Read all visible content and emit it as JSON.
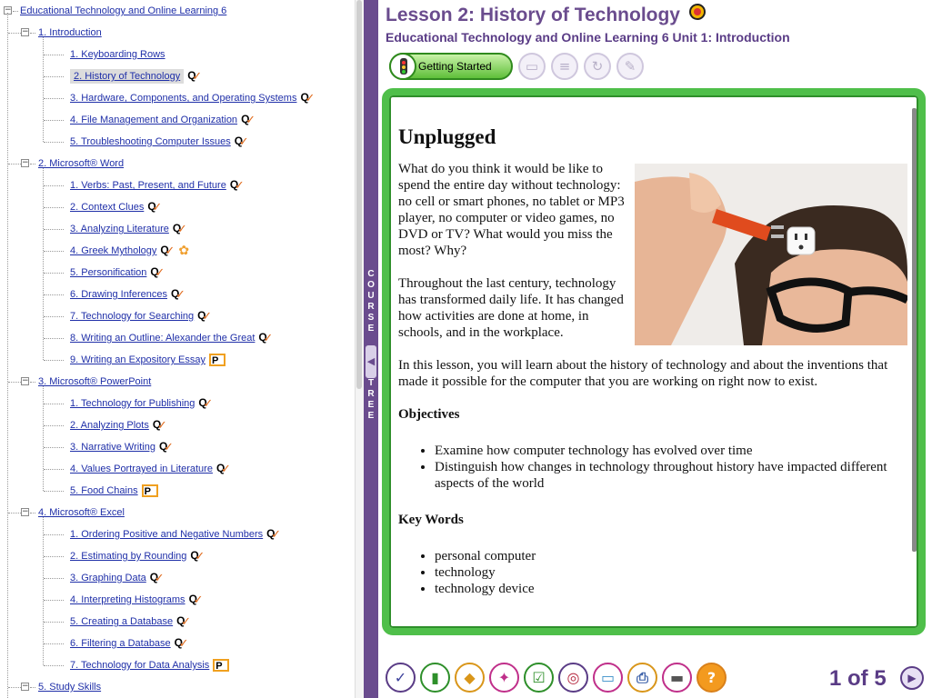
{
  "course": {
    "title": "Educational Technology and Online Learning 6",
    "units": [
      {
        "label": "1. Introduction",
        "lessons": [
          {
            "label": "1. Keyboarding Rows",
            "badge": ""
          },
          {
            "label": "2. History of Technology",
            "badge": "quiz",
            "selected": true
          },
          {
            "label": "3. Hardware, Components, and Operating Systems",
            "badge": "quiz"
          },
          {
            "label": "4. File Management and Organization",
            "badge": "quiz"
          },
          {
            "label": "5. Troubleshooting Computer Issues",
            "badge": "quiz"
          }
        ]
      },
      {
        "label": "2. Microsoft® Word",
        "lessons": [
          {
            "label": "1. Verbs: Past, Present, and Future",
            "badge": "quiz"
          },
          {
            "label": "2. Context Clues",
            "badge": "quiz"
          },
          {
            "label": "3. Analyzing Literature",
            "badge": "quiz"
          },
          {
            "label": "4. Greek Mythology",
            "badge": "quiz-flower"
          },
          {
            "label": "5. Personification",
            "badge": "quiz"
          },
          {
            "label": "6. Drawing Inferences",
            "badge": "quiz"
          },
          {
            "label": "7. Technology for Searching",
            "badge": "quiz"
          },
          {
            "label": "8. Writing an Outline: Alexander the Great",
            "badge": "quiz"
          },
          {
            "label": "9. Writing an Expository Essay",
            "badge": "project"
          }
        ]
      },
      {
        "label": "3. Microsoft® PowerPoint",
        "lessons": [
          {
            "label": "1. Technology for Publishing",
            "badge": "quiz"
          },
          {
            "label": "2. Analyzing Plots",
            "badge": "quiz"
          },
          {
            "label": "3. Narrative Writing",
            "badge": "quiz"
          },
          {
            "label": "4. Values Portrayed in Literature",
            "badge": "quiz"
          },
          {
            "label": "5. Food Chains",
            "badge": "project"
          }
        ]
      },
      {
        "label": "4. Microsoft® Excel",
        "lessons": [
          {
            "label": "1. Ordering Positive and Negative Numbers",
            "badge": "quiz"
          },
          {
            "label": "2. Estimating by Rounding",
            "badge": "quiz"
          },
          {
            "label": "3. Graphing Data",
            "badge": "quiz"
          },
          {
            "label": "4. Interpreting Histograms",
            "badge": "quiz"
          },
          {
            "label": "5. Creating a Database",
            "badge": "quiz"
          },
          {
            "label": "6. Filtering a Database",
            "badge": "quiz"
          },
          {
            "label": "7. Technology for Data Analysis",
            "badge": "project"
          }
        ]
      },
      {
        "label": "5. Study Skills",
        "lessons": []
      }
    ]
  },
  "divider": {
    "label": "COURSE TREE"
  },
  "header": {
    "lesson_title": "Lesson 2: History of Technology",
    "subtitle": "Educational Technology and Online Learning 6  Unit 1: Introduction"
  },
  "toolbar": {
    "getting_started": "Getting Started"
  },
  "content": {
    "heading": "Unplugged",
    "para1": "What do you think it would be like to spend the entire day without technology: no cell or smart phones, no tablet or MP3 player, no computer or video games, no DVD or TV? What would you miss the most? Why?",
    "para2": "Throughout the last century, technology has transformed daily life. It has changed how activities are done at home, in schools, and in the workplace.",
    "para3": "In this lesson, you will learn about the history of technology and about the inventions that made it possible for the computer that you are working on right now to exist.",
    "objectives_heading": "Objectives",
    "objectives": [
      "Examine how computer technology has evolved over time",
      "Distinguish how changes in technology throughout history have impacted different aspects of the world"
    ],
    "keywords_heading": "Key Words",
    "keywords": [
      "personal computer",
      "technology",
      "technology device"
    ]
  },
  "pagination": {
    "text": "1 of 5"
  },
  "colors": {
    "accent": "#5a3c86",
    "frame": "#4fbf4a",
    "link": "#1f2fa8"
  }
}
